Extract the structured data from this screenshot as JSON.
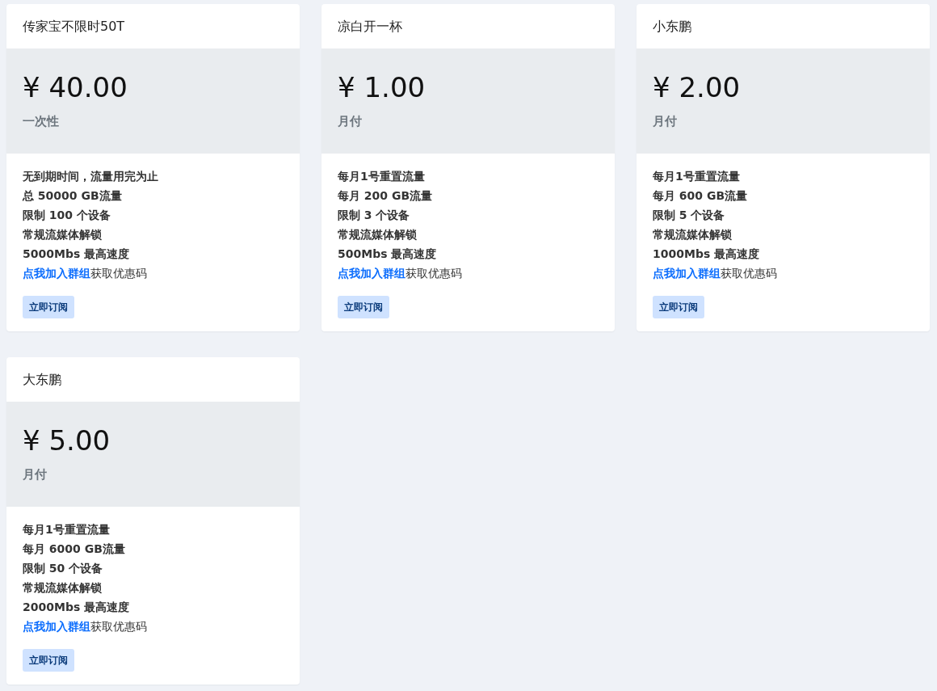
{
  "plans": [
    {
      "name": "传家宝不限时50T",
      "price": "¥ 40.00",
      "period": "一次性",
      "features": [
        "无到期时间，流量用完为止",
        "总 50000 GB流量",
        "限制 100 个设备",
        "常规流媒体解锁",
        "5000Mbs 最高速度"
      ],
      "promo": {
        "link": "点我加入群组",
        "text": "获取优惠码"
      },
      "button": "立即订阅"
    },
    {
      "name": "凉白开一杯",
      "price": "¥ 1.00",
      "period": "月付",
      "features": [
        "每月1号重置流量",
        "每月 200 GB流量",
        "限制 3 个设备",
        "常规流媒体解锁",
        "500Mbs 最高速度"
      ],
      "promo": {
        "link": "点我加入群组",
        "text": "获取优惠码"
      },
      "button": "立即订阅"
    },
    {
      "name": "小东鹏",
      "price": "¥ 2.00",
      "period": "月付",
      "features": [
        "每月1号重置流量",
        "每月 600 GB流量",
        "限制 5 个设备",
        "常规流媒体解锁",
        "1000Mbs 最高速度"
      ],
      "promo": {
        "link": "点我加入群组",
        "text": "获取优惠码"
      },
      "button": "立即订阅"
    },
    {
      "name": "大东鹏",
      "price": "¥ 5.00",
      "period": "月付",
      "features": [
        "每月1号重置流量",
        "每月 6000 GB流量",
        "限制 50 个设备",
        "常规流媒体解锁",
        "2000Mbs 最高速度"
      ],
      "promo": {
        "link": "点我加入群组",
        "text": "获取优惠码"
      },
      "button": "立即订阅"
    }
  ]
}
